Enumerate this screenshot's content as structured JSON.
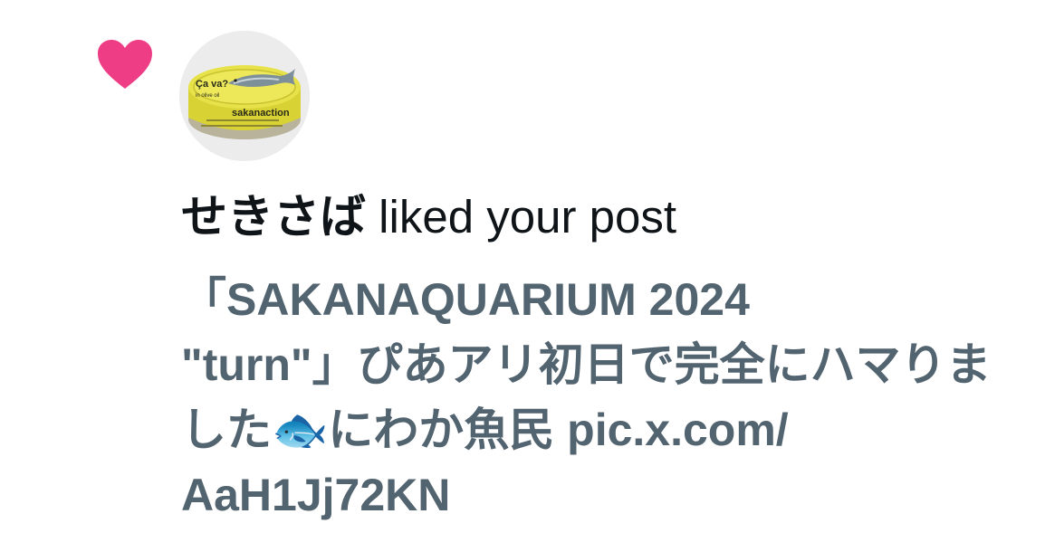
{
  "notification": {
    "type_icon": "heart-icon",
    "accent_color": "#ee3c85",
    "avatar": {
      "can_text_line1": "Ça va?",
      "can_text_line2": "in olive oil",
      "brand": "sakanaction"
    },
    "user_name": "せきさば",
    "action_text": " liked your post",
    "post_text": "「SAKANAQUARIUM 2024\n\"turn\"」ぴあアリ初日で完全にハマりました🐟にわか魚民 pic.x.com/\nAaH1Jj72KN"
  }
}
